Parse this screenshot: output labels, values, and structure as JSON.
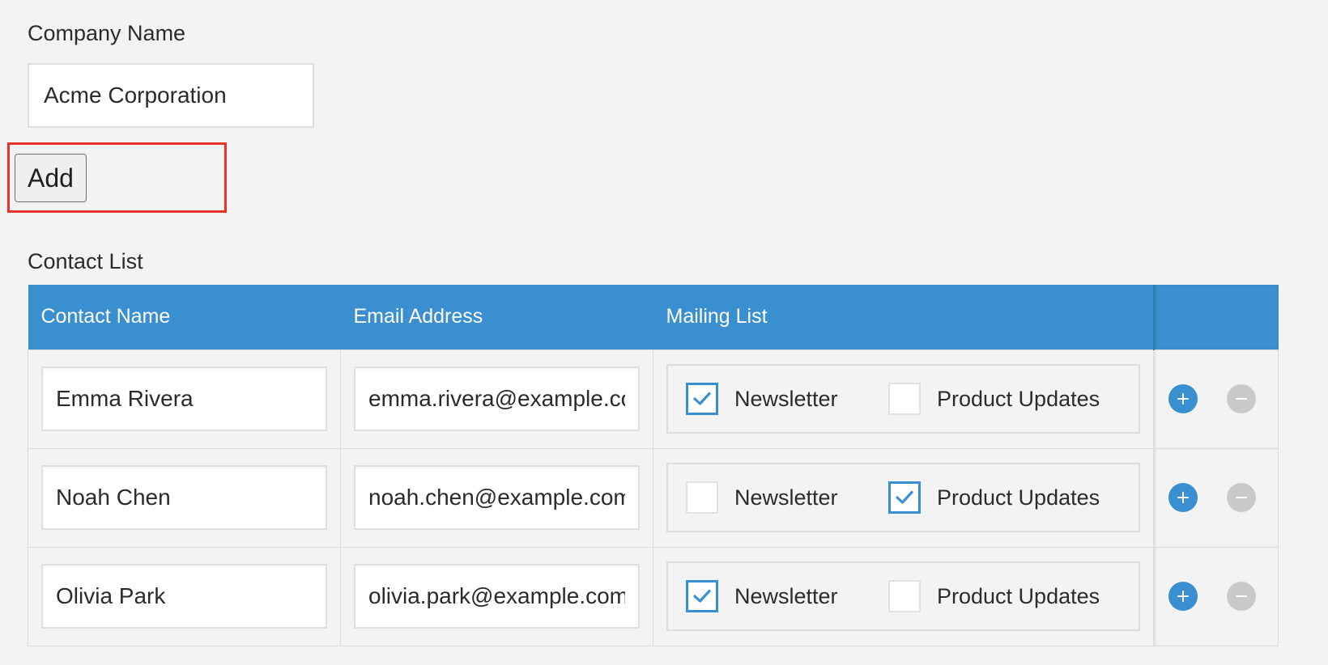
{
  "company": {
    "label": "Company Name",
    "value": "Acme Corporation"
  },
  "add_button": {
    "label": "Add"
  },
  "contact_list": {
    "label": "Contact List",
    "columns": [
      "Contact Name",
      "Email Address",
      "Mailing List"
    ],
    "options": [
      "Newsletter",
      "Product Updates"
    ],
    "rows": [
      {
        "name": "Emma Rivera",
        "email": "emma.rivera@example.com",
        "newsletter": true,
        "product_updates": false
      },
      {
        "name": "Noah Chen",
        "email": "noah.chen@example.com",
        "newsletter": false,
        "product_updates": true
      },
      {
        "name": "Olivia Park",
        "email": "olivia.park@example.com",
        "newsletter": true,
        "product_updates": false
      }
    ]
  },
  "icons": {
    "check": "checkmark-icon",
    "row_add": "plus-circle-icon",
    "row_remove": "minus-circle-icon"
  },
  "colors": {
    "header_bg": "#3a8fd1",
    "accent": "#3a8fd1",
    "highlight": "#e8322a",
    "remove_btn": "#c9c9c9"
  }
}
